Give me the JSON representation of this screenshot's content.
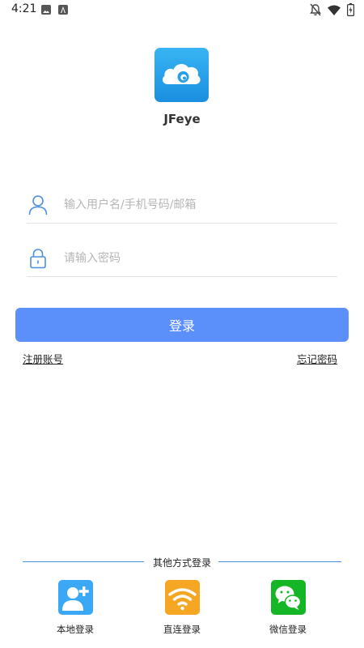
{
  "status_bar": {
    "time": "4:21",
    "left_icons": [
      "photo-icon",
      "font-icon"
    ],
    "right_icons": [
      "notifications-off-icon",
      "wifi-icon",
      "battery-icon"
    ]
  },
  "app": {
    "name": "JFeye",
    "logo_icon": "cloud-camera-icon",
    "brand_color": "#2aa2ec"
  },
  "login_form": {
    "username_placeholder": "输入用户名/手机号码/邮箱",
    "username_icon": "user-icon",
    "password_placeholder": "请输入密码",
    "password_icon": "lock-icon",
    "submit_label": "登录",
    "submit_color": "#5b8ff9",
    "register_link": "注册账号",
    "forgot_link": "忘记密码"
  },
  "other_methods": {
    "title": "其他方式登录",
    "items": [
      {
        "label": "本地登录",
        "icon": "add-user-icon",
        "color": "#3aa8f5"
      },
      {
        "label": "直连登录",
        "icon": "wifi-icon",
        "color": "#f5a623"
      },
      {
        "label": "微信登录",
        "icon": "wechat-icon",
        "color": "#15b626"
      }
    ]
  }
}
